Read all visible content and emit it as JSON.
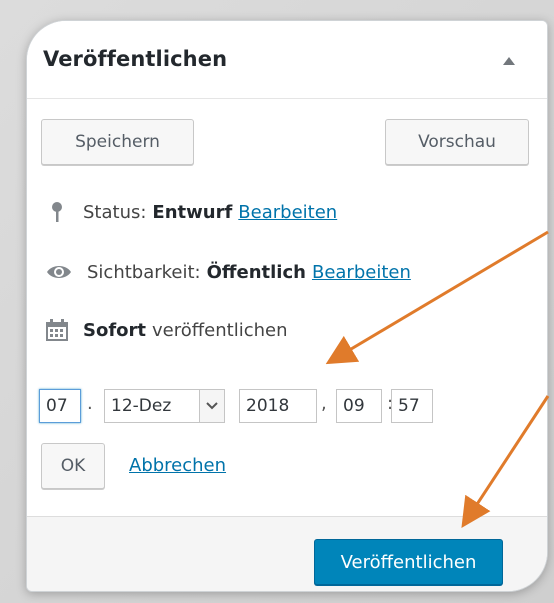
{
  "panel": {
    "title": "Veröffentlichen"
  },
  "buttons": {
    "save": "Speichern",
    "preview": "Vorschau",
    "ok": "OK",
    "cancel": "Abbrechen",
    "publish": "Veröffentlichen"
  },
  "status": {
    "label": "Status:",
    "value": "Entwurf",
    "edit": "Bearbeiten"
  },
  "visibility": {
    "label": "Sichtbarkeit:",
    "value": "Öffentlich",
    "edit": "Bearbeiten"
  },
  "schedule": {
    "strong": "Sofort",
    "rest": "veröffentlichen"
  },
  "date": {
    "day": "07",
    "month": "12-Dez",
    "year": "2018",
    "hour": "09",
    "minute": "57",
    "sep_day": ".",
    "sep_year": ",",
    "sep_time": ":"
  },
  "colors": {
    "link": "#0073aa",
    "publish_button": "#0085ba",
    "annotation_arrow": "#e07b2b"
  },
  "icons": {
    "status": "pin-icon",
    "visibility": "eye-icon",
    "schedule": "calendar-icon",
    "collapse": "triangle-up-icon",
    "select": "chevron-down-icon"
  }
}
